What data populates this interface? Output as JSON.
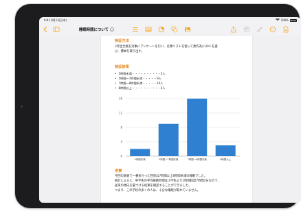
{
  "status_bar": {
    "time_date": "9:41 8月13日(木)",
    "battery": "100%"
  },
  "toolbar": {
    "title": "睡眠時間について"
  },
  "document": {
    "method_heading": "検証方法",
    "method_text_1": "3年生全員を対象にアンケートを行い、名簿リストを使って無作為に30人を選",
    "method_text_2": "び、標本を取り出す。",
    "result_heading": "検証結果",
    "result_items": [
      "5時間未満・・・・・・・・・・2人",
      "5時間〜7時間未満・・・・・9人",
      "7時間〜8時間未満・・・・・16人",
      "8時間以上・・・・・・・・・・3人"
    ],
    "discussion_heading": "考察",
    "discussion_lines": [
      "今回の調査で一番多かった回答は7時間以上8時間未満の睡眠でした。",
      "統計によると、中学生の平均睡眠時間は小学生より1時間程度7時間2分なので、",
      "従来の傾向を裏づける結果を確認することができました。",
      "つまり、この学校の多くの人は、十分な睡眠が取れていません。"
    ]
  },
  "chart_data": {
    "type": "bar",
    "categories": [
      "5時間未満",
      "5時間〜7時間未満",
      "7時間〜8時間未満",
      "8時間以上"
    ],
    "values": [
      2,
      9,
      16,
      3
    ],
    "ylim": [
      0,
      16
    ],
    "yticks": [
      0,
      4,
      8,
      12,
      16
    ],
    "bar_color": "#2f80d1",
    "grid": true
  },
  "colors": {
    "accent": "#f5a623",
    "heading": "#e28a1d"
  }
}
